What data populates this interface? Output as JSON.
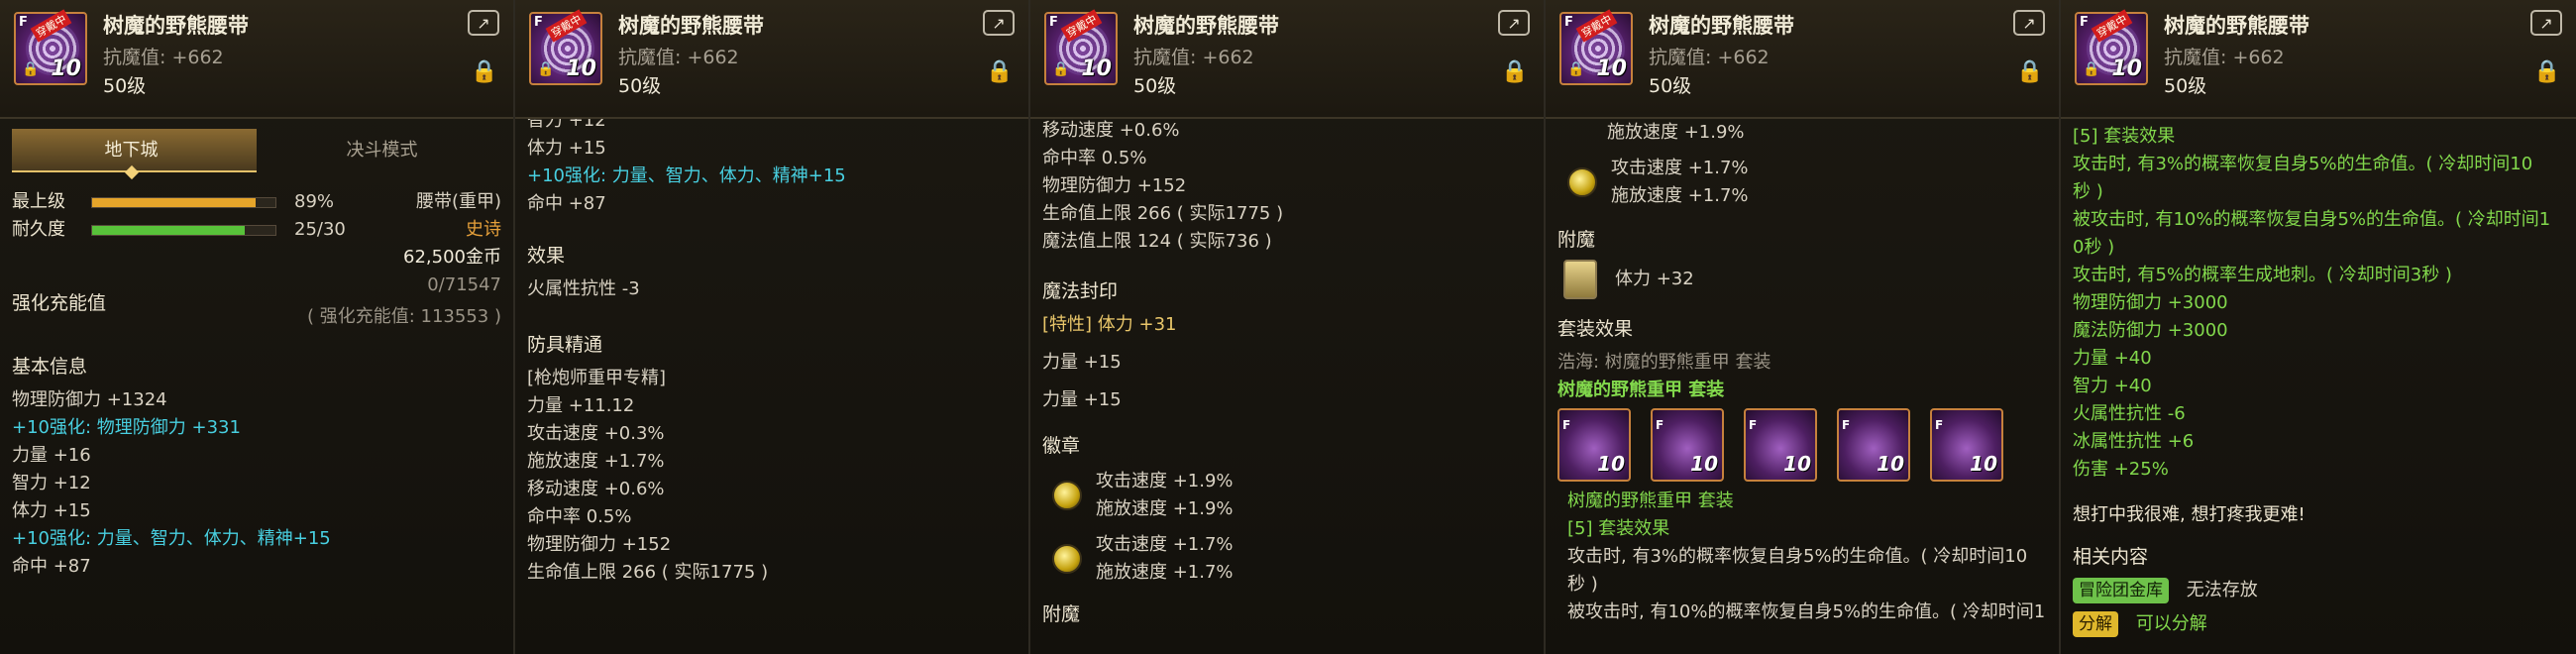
{
  "item": {
    "name": "树魔的野熊腰带",
    "stat_line": "抗魔值: +662",
    "level": "50级",
    "icon_level": "10",
    "icon_cap": "F",
    "icon_tag": "穿戴中"
  },
  "p1": {
    "tabs": [
      "地下城",
      "决斗模式"
    ],
    "bars": [
      {
        "label": "最上级",
        "value": "89%",
        "fill": 0.89,
        "color": "#e6a52a"
      },
      {
        "label": "耐久度",
        "value": "25/30",
        "fill": 0.83,
        "color": "#58c23a"
      }
    ],
    "slot": "腰带(重甲)",
    "rarity": "史诗",
    "price": "62,500金币",
    "charge_label": "强化充能值",
    "charge_value": "0/71547",
    "charge_sub": "( 强化充能值: 113553 )",
    "basic_title": "基本信息",
    "lines": [
      {
        "t": "物理防御力 +1324",
        "c": ""
      },
      {
        "t": "+10强化: 物理防御力 +331",
        "c": "cyan"
      },
      {
        "t": "力量 +16",
        "c": ""
      },
      {
        "t": "智力 +12",
        "c": ""
      },
      {
        "t": "体力 +15",
        "c": ""
      },
      {
        "t": "+10强化: 力量、智力、体力、精神+15",
        "c": "cyan"
      },
      {
        "t": "命中 +87",
        "c": ""
      }
    ]
  },
  "p2": {
    "top_lines": [
      {
        "t": "智力 +12",
        "c": ""
      },
      {
        "t": "体力 +15",
        "c": ""
      },
      {
        "t": "+10强化: 力量、智力、体力、精神+15",
        "c": "cyan"
      },
      {
        "t": "命中 +87",
        "c": ""
      }
    ],
    "effect_title": "效果",
    "effect_line": "火属性抗性 -3",
    "mastery_title": "防具精通",
    "mastery_lines": [
      "[枪炮师重甲专精]",
      "力量 +11.12",
      "攻击速度 +0.3%",
      "施放速度 +1.7%",
      "移动速度 +0.6%",
      "命中率 0.5%",
      "物理防御力 +152",
      "生命值上限 266 ( 实际1775 )"
    ]
  },
  "p3": {
    "top_lines": [
      "移动速度 +0.6%",
      "命中率 0.5%",
      "物理防御力 +152",
      "生命值上限 266 ( 实际1775 )",
      "魔法值上限 124 ( 实际736 )"
    ],
    "seal_title": "魔法封印",
    "seal_lines": [
      {
        "t": "[特性] 体力 +31",
        "c": "gold"
      },
      {
        "t": "力量 +15",
        "c": ""
      },
      {
        "t": "力量 +15",
        "c": ""
      }
    ],
    "emblem_title": "徽章",
    "emblems": [
      {
        "a": "攻击速度 +1.9%",
        "b": "施放速度 +1.9%"
      },
      {
        "a": "攻击速度 +1.7%",
        "b": "施放速度 +1.7%"
      }
    ],
    "cut_title": "附魔"
  },
  "p4": {
    "top_line": "施放速度 +1.9%",
    "emblem": {
      "a": "攻击速度 +1.7%",
      "b": "施放速度 +1.7%"
    },
    "ench_title": "附魔",
    "ench_line": "体力 +32",
    "set_title": "套装效果",
    "set_sub": "浩海: 树魔的野熊重甲 套装",
    "set_name": "树魔的野熊重甲  套装",
    "set_name2": "树魔的野熊重甲  套装",
    "set_bonus": "[5] 套装效果",
    "set_lines": [
      "攻击时, 有3%的概率恢复自身5%的生命值。( 冷却时间10",
      "秒 )",
      "被攻击时, 有10%的概率恢复自身5%的生命值。( 冷却时间1"
    ],
    "icon_level": "10"
  },
  "p5": {
    "set_bonus": "[5] 套装效果",
    "lines": [
      "攻击时, 有3%的概率恢复自身5%的生命值。( 冷却时间10",
      "秒 )",
      "被攻击时, 有10%的概率恢复自身5%的生命值。( 冷却时间1",
      "0秒 )",
      "攻击时, 有5%的概率生成地刺。( 冷却时间3秒 )",
      "物理防御力 +3000",
      "魔法防御力 +3000",
      "力量 +40",
      "智力 +40",
      "火属性抗性 -6",
      "冰属性抗性 +6",
      "伤害 +25%"
    ],
    "flavor": "想打中我很难, 想打疼我更难!",
    "related_title": "相关内容",
    "storage_badge": "冒险团金库",
    "storage_text": "无法存放",
    "decompose_badge": "分解",
    "decompose_text": "可以分解"
  }
}
